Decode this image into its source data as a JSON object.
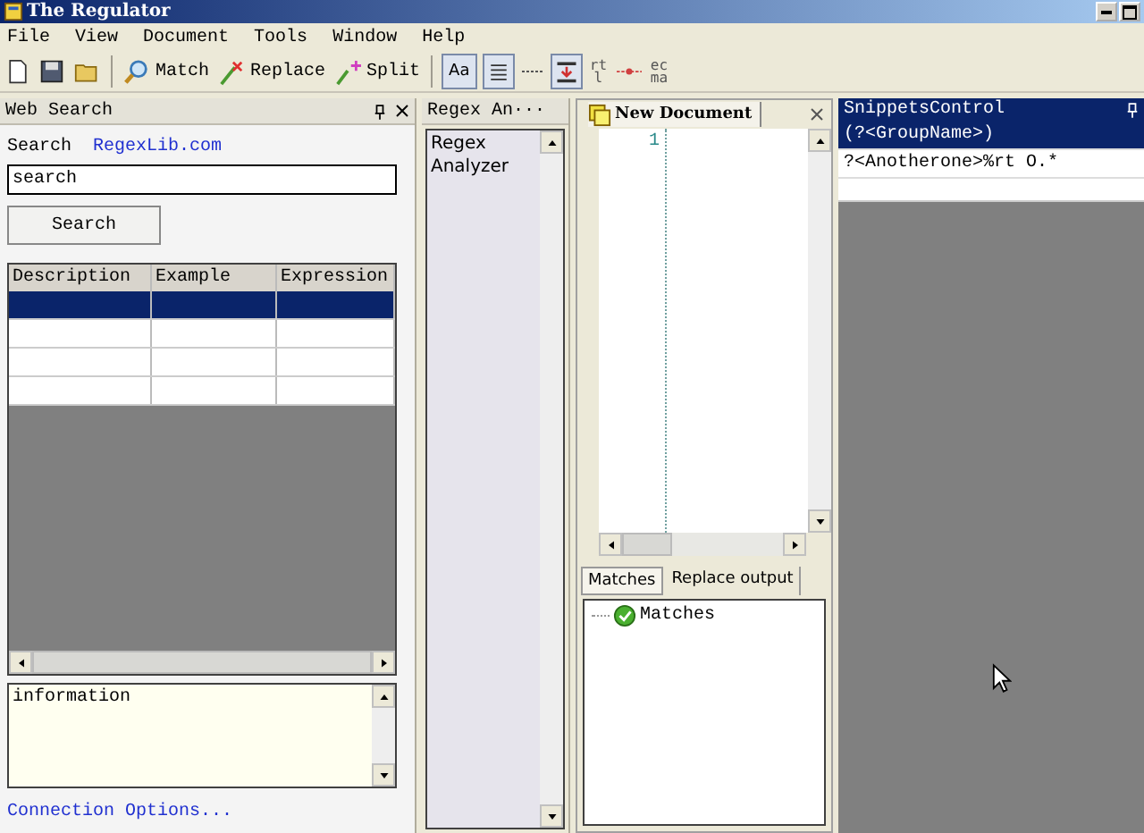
{
  "window": {
    "title": "The Regulator"
  },
  "menu": [
    "File",
    "View",
    "Document",
    "Tools",
    "Window",
    "Help"
  ],
  "toolbar": [
    {
      "kind": "new"
    },
    {
      "kind": "save"
    },
    {
      "kind": "open"
    },
    {
      "kind": "sep"
    },
    {
      "kind": "match",
      "label": "Match"
    },
    {
      "kind": "replace",
      "label": "Replace"
    },
    {
      "kind": "split",
      "label": "Split"
    },
    {
      "kind": "sep"
    },
    {
      "kind": "toggle",
      "label": "Aa",
      "on": true
    },
    {
      "kind": "lines",
      "on": true
    },
    {
      "kind": "dots"
    },
    {
      "kind": "insert",
      "on": true
    },
    {
      "kind": "label",
      "label": "rtl"
    },
    {
      "kind": "marker"
    },
    {
      "kind": "label",
      "label": "ecma"
    }
  ],
  "web_search": {
    "title": "Web Search",
    "search_label": "Search",
    "link": "RegexLib.com",
    "query": "search",
    "button": "Search",
    "columns": [
      "Description",
      "Example",
      "Expression"
    ],
    "rows": [
      {
        "selected": true
      },
      {
        "selected": false
      },
      {
        "selected": false
      },
      {
        "selected": false
      }
    ],
    "info": "information",
    "options_link": "Connection Options..."
  },
  "regex_analyzer": {
    "title": "Regex An···",
    "text": "Regex Analyzer"
  },
  "document": {
    "tab": "New Document",
    "line_numbers": [
      "1"
    ],
    "output_tabs": [
      {
        "label": "Matches",
        "selected": true
      },
      {
        "label": "Replace output",
        "selected": false
      }
    ],
    "tree": [
      {
        "label": "Matches"
      }
    ]
  },
  "snippets": {
    "title": "SnippetsControl",
    "items": [
      {
        "text": "(?<GroupName>)",
        "selected": true
      },
      {
        "text": "?<Anotherone>%rt O.*",
        "selected": false
      }
    ]
  }
}
